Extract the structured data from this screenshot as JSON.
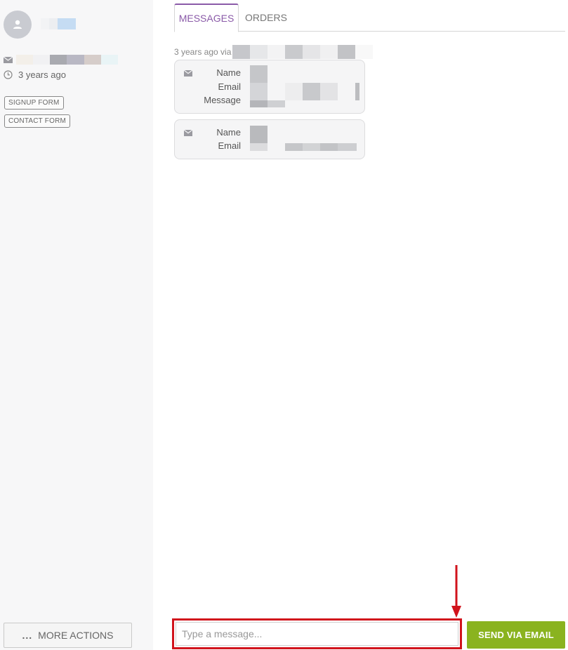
{
  "sidebar": {
    "last_seen": "3 years ago",
    "tags": [
      "SIGNUP FORM",
      "CONTACT FORM"
    ],
    "more_actions_label": "MORE ACTIONS",
    "more_actions_prefix": "..."
  },
  "tabs": [
    {
      "label": "MESSAGES",
      "active": true
    },
    {
      "label": "ORDERS",
      "active": false
    }
  ],
  "conversation": {
    "meta_text": "3 years ago via",
    "messages": [
      {
        "fields": [
          "Name",
          "Email",
          "Message"
        ]
      },
      {
        "fields": [
          "Name",
          "Email"
        ]
      }
    ]
  },
  "composer": {
    "placeholder": "Type a message...",
    "send_label": "SEND VIA EMAIL"
  },
  "colors": {
    "accent_purple": "#8a5aa8",
    "send_green": "#8ab31f",
    "highlight_red": "#d1131c",
    "sidebar_bg": "#f7f7f8"
  },
  "icons": {
    "avatar": "user-icon",
    "email": "mail-icon",
    "time": "clock-icon",
    "annotation": "arrow-down-icon"
  }
}
